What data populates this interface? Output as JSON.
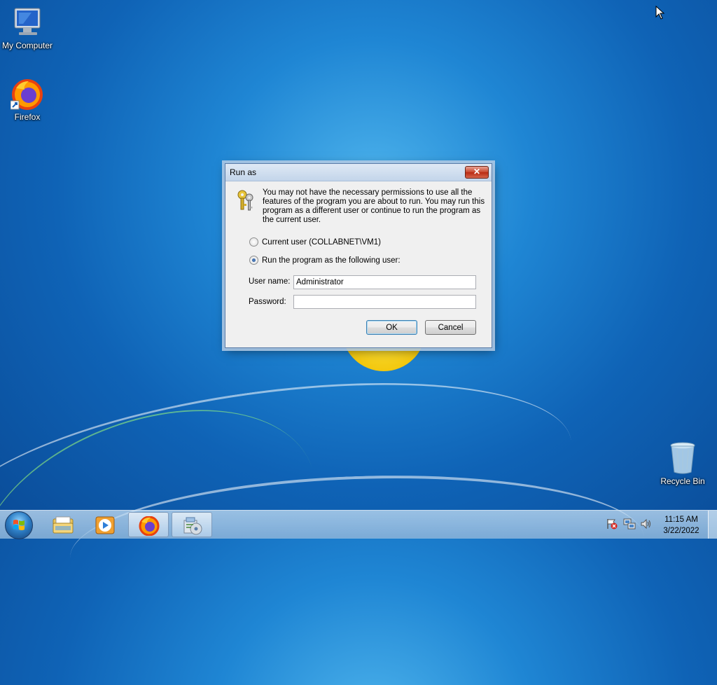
{
  "desktop": {
    "icons": [
      {
        "label": "My Computer",
        "icon": "computer-icon"
      },
      {
        "label": "Firefox",
        "icon": "firefox-icon"
      },
      {
        "label": "Recycle Bin",
        "icon": "recycle-bin-icon"
      }
    ]
  },
  "dialog": {
    "title": "Run as",
    "close_label": "✕",
    "icon": "keys-icon",
    "message": "You may not have the necessary permissions to use all the features of the program you are about to run. You may run this program as a different user or continue to run the program as the current user.",
    "options": [
      {
        "label": "Current user (COLLABNET\\VM1)",
        "checked": false
      },
      {
        "label": "Run the program as the following user:",
        "checked": true
      }
    ],
    "username_label": "User name:",
    "username_value": "Administrator",
    "password_label": "Password:",
    "password_value": "",
    "ok_label": "OK",
    "cancel_label": "Cancel"
  },
  "taskbar": {
    "items": [
      {
        "icon": "file-explorer-icon",
        "active": false
      },
      {
        "icon": "media-player-icon",
        "active": false
      },
      {
        "icon": "firefox-icon",
        "active": true
      },
      {
        "icon": "install-package-icon",
        "active": true
      }
    ],
    "tray_icons": [
      "action-center-flag-icon",
      "network-icon",
      "volume-icon"
    ],
    "clock": {
      "time": "11:15 AM",
      "date": "3/22/2022"
    }
  },
  "colors": {
    "desktop_background": "#1f86d4",
    "dialog_background": "#f0f0f0",
    "close_button": "#c7442b"
  }
}
